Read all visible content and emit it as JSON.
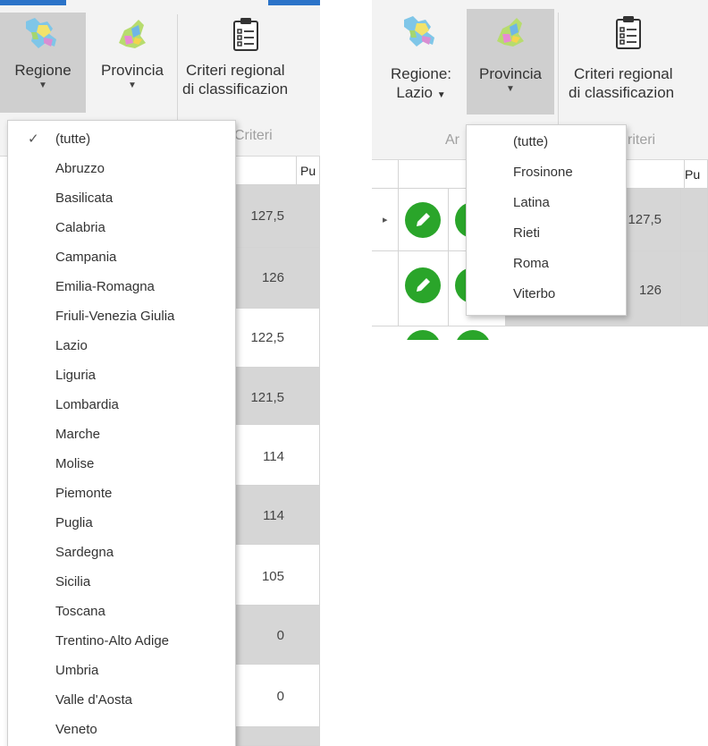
{
  "left_panel": {
    "ribbon": {
      "regione_label": "Regione",
      "provincia_label": "Provincia",
      "criteri_line1": "Criteri regional",
      "criteri_line2": "di classificazion",
      "group_label": "Criteri",
      "caret": "▼"
    },
    "grid": {
      "header_partial": "Pu",
      "values": [
        "127,5",
        "126",
        "122,5",
        "121,5",
        "114",
        "114",
        "105",
        "0",
        "0"
      ]
    },
    "dropdown_regione": {
      "selected_mark": "✓",
      "items": [
        "(tutte)",
        "Abruzzo",
        "Basilicata",
        "Calabria",
        "Campania",
        "Emilia-Romagna",
        "Friuli-Venezia Giulia",
        "Lazio",
        "Liguria",
        "Lombardia",
        "Marche",
        "Molise",
        "Piemonte",
        "Puglia",
        "Sardegna",
        "Sicilia",
        "Toscana",
        "Trentino-Alto Adige",
        "Umbria",
        "Valle d'Aosta",
        "Veneto"
      ]
    }
  },
  "right_panel": {
    "ribbon": {
      "regione_label": "Regione:",
      "regione_value": "Lazio",
      "provincia_label": "Provincia",
      "criteri_line1": "Criteri regional",
      "criteri_line2": "di classificazion",
      "group_label_partial": "Ar",
      "criteri_partial": "riteri",
      "caret": "▼"
    },
    "grid": {
      "header_partial": "Pu",
      "values": [
        "127,5",
        "126"
      ],
      "row_indicator": "▸"
    },
    "dropdown_provincia": {
      "items": [
        "(tutte)",
        "Frosinone",
        "Latina",
        "Rieti",
        "Roma",
        "Viterbo"
      ]
    }
  },
  "colors": {
    "accent_blue": "#2b73c8",
    "pressed_gray": "#cfcfcf",
    "row_gray": "#d6d6d6",
    "edit_green": "#2aa52a"
  }
}
